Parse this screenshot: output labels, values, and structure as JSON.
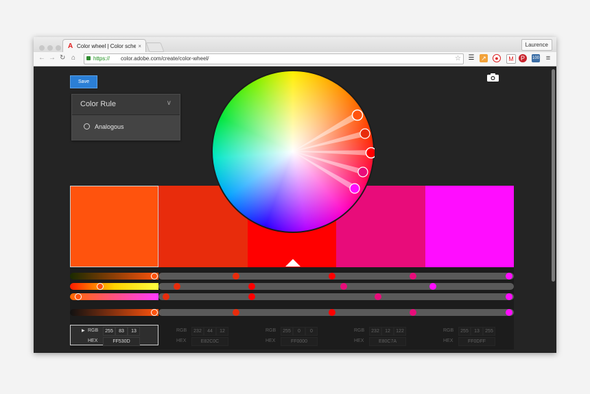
{
  "browser": {
    "tab_title": "Color wheel | Color schemes",
    "tab_close": "×",
    "user_button": "Laurence",
    "url_scheme": "https://",
    "url_rest": "color.adobe.com/create/color-wheel/"
  },
  "toolbar": {
    "save_label": "Save"
  },
  "color_rule": {
    "title": "Color Rule",
    "selected": "Analogous"
  },
  "swatches": [
    {
      "hex": "#FF530D",
      "rgb": [
        255,
        83,
        13
      ],
      "hex_label": "FF530D",
      "active": true
    },
    {
      "hex": "#E82C0C",
      "rgb": [
        232,
        44,
        12
      ],
      "hex_label": "E82C0C",
      "active": false
    },
    {
      "hex": "#FF0000",
      "rgb": [
        255,
        0,
        0
      ],
      "hex_label": "FF0000",
      "active": false
    },
    {
      "hex": "#E80C7A",
      "rgb": [
        232,
        12,
        122
      ],
      "hex_label": "E80C7A",
      "active": false
    },
    {
      "hex": "#FF0DFF",
      "rgb": [
        255,
        13,
        255
      ],
      "hex_label": "FF0DFF",
      "active": false
    }
  ],
  "labels": {
    "rgb": "RGB",
    "hex": "HEX"
  },
  "colors": {
    "accent": "#2b7fd6",
    "page_bg": "#242424"
  }
}
